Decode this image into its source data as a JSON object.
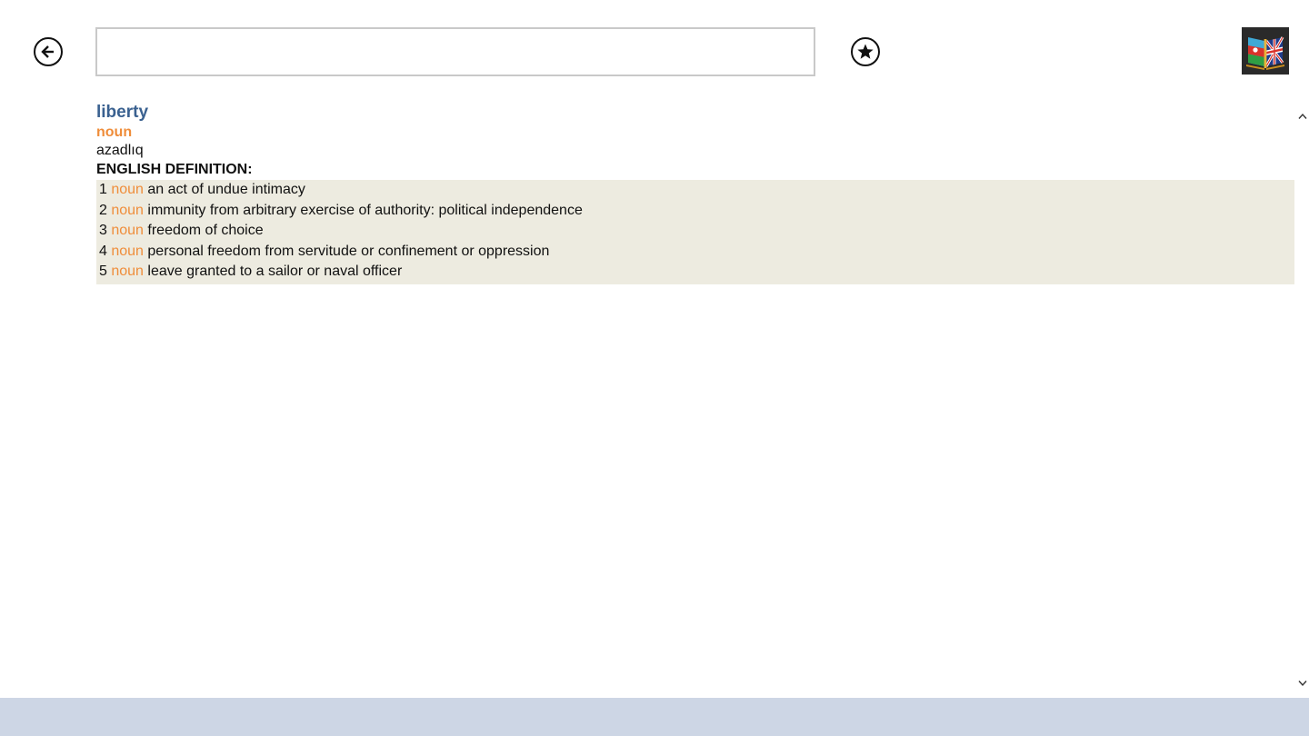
{
  "search": {
    "value": "",
    "placeholder": ""
  },
  "entry": {
    "headword": "liberty",
    "part_of_speech": "noun",
    "translation": "azadlıq",
    "definition_heading": "ENGLISH DEFINITION:",
    "definitions": [
      {
        "number": "1",
        "pos": "noun",
        "text": "an act of undue intimacy"
      },
      {
        "number": "2",
        "pos": "noun",
        "text": "immunity from arbitrary exercise of authority: political independence"
      },
      {
        "number": "3",
        "pos": "noun",
        "text": "freedom of choice"
      },
      {
        "number": "4",
        "pos": "noun",
        "text": "personal freedom from servitude or confinement or oppression"
      },
      {
        "number": "5",
        "pos": "noun",
        "text": "leave granted to a sailor or naval officer"
      }
    ]
  },
  "icons": {
    "back": "back-arrow-icon",
    "favorite": "star-icon",
    "logo": "dictionary-book-icon",
    "scroll_up": "chevron-up-icon",
    "scroll_down": "chevron-down-icon"
  },
  "colors": {
    "headword": "#3a6190",
    "pos": "#ef8d3a",
    "definition_background": "#edebe0",
    "bottom_bar": "#cdd6e5"
  }
}
